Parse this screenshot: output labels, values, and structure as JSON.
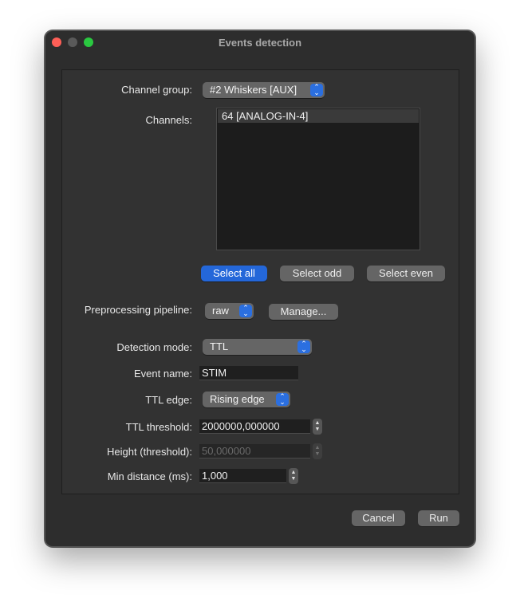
{
  "window": {
    "title": "Events detection"
  },
  "form": {
    "channel_group_label": "Channel group:",
    "channel_group_value": "#2 Whiskers [AUX]",
    "channels_label": "Channels:",
    "channels": [
      "64 [ANALOG-IN-4]"
    ],
    "select_all": "Select all",
    "select_odd": "Select odd",
    "select_even": "Select even",
    "preprocessing_label": "Preprocessing pipeline:",
    "preprocessing_value": "raw",
    "manage_button": "Manage...",
    "detection_mode_label": "Detection mode:",
    "detection_mode_value": "TTL",
    "event_name_label": "Event name:",
    "event_name_value": "STIM",
    "ttl_edge_label": "TTL edge:",
    "ttl_edge_value": "Rising edge",
    "ttl_threshold_label": "TTL threshold:",
    "ttl_threshold_value": "2000000,000000",
    "height_label": "Height (threshold):",
    "height_value": "50,000000",
    "min_distance_label": "Min distance (ms):",
    "min_distance_value": "1,000"
  },
  "footer": {
    "cancel": "Cancel",
    "run": "Run"
  },
  "colors": {
    "accent": "#2467d9",
    "window_bg": "#2d2d2d",
    "panel_bg": "#323232"
  }
}
